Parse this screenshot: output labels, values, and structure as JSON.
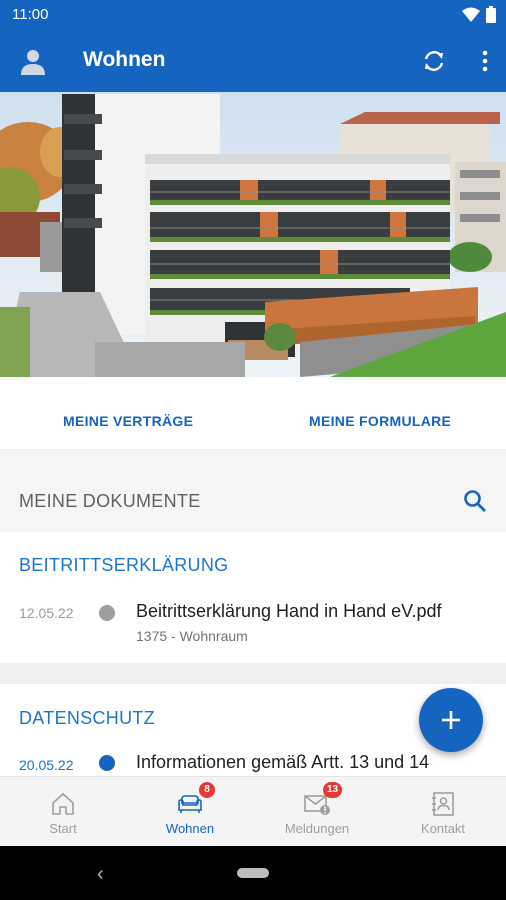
{
  "status_bar": {
    "time": "11:00",
    "icons": [
      "wifi-icon",
      "battery-icon"
    ]
  },
  "app_bar": {
    "title": "Wohnen",
    "icons": [
      "avatar-icon",
      "sync-icon",
      "more-vert-icon"
    ]
  },
  "quick_links": {
    "contracts": "MEINE VERTRÄGE",
    "forms": "MEINE FORMULARE"
  },
  "documents": {
    "header": "MEINE DOKUMENTE",
    "sections": [
      {
        "category": "BEITRITTSERKLÄRUNG",
        "items": [
          {
            "date": "12.05.22",
            "title": "Beitrittserklärung Hand in Hand eV.pdf",
            "subtitle": "1375 - Wohnraum",
            "read": true
          }
        ]
      },
      {
        "category": "DATENSCHUTZ",
        "items": [
          {
            "date": "20.05.22",
            "title": "Informationen gemäß Artt. 13 und 14",
            "read": false
          }
        ]
      }
    ]
  },
  "bottom_nav": [
    {
      "label": "Start",
      "icon": "home-icon"
    },
    {
      "label": "Wohnen",
      "icon": "sofa-icon",
      "badge": "8",
      "active": true
    },
    {
      "label": "Meldungen",
      "icon": "mail-alert-icon",
      "badge": "13"
    },
    {
      "label": "Kontakt",
      "icon": "contact-book-icon"
    }
  ],
  "colors": {
    "primary": "#1565c0",
    "accent": "#1976d2",
    "badge": "#e53935",
    "read_dot": "#9e9e9e",
    "unread_dot": "#1565c0"
  }
}
